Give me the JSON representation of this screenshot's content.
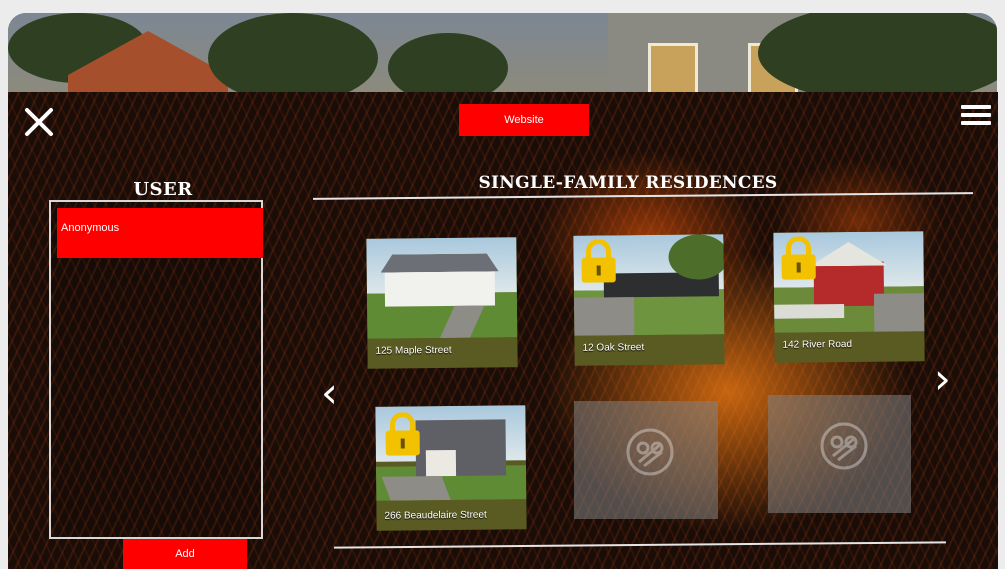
{
  "header": {
    "website_label": "Website"
  },
  "user_panel": {
    "title": "USER",
    "users": [
      "Anonymous"
    ],
    "add_label": "Add"
  },
  "residences": {
    "title": "SINGLE-FAMILY RESIDENCES",
    "cards": [
      {
        "label": "125 Maple Street",
        "locked": false
      },
      {
        "label": "12 Oak Street",
        "locked": true
      },
      {
        "label": "142 River Road",
        "locked": true
      },
      {
        "label": "266 Beaudelaire Street",
        "locked": true
      },
      {
        "label": "",
        "locked": false,
        "empty": true
      },
      {
        "label": "",
        "locked": false,
        "empty": true
      }
    ]
  },
  "icons": {
    "close": "close-icon",
    "menu": "hamburger-menu-icon",
    "prev": "chevron-left-icon",
    "next": "chevron-right-icon",
    "lock": "padlock-icon",
    "placeholder": "owl-logo-icon"
  },
  "colors": {
    "accent": "#ff0000",
    "lock": "#f2c200"
  }
}
